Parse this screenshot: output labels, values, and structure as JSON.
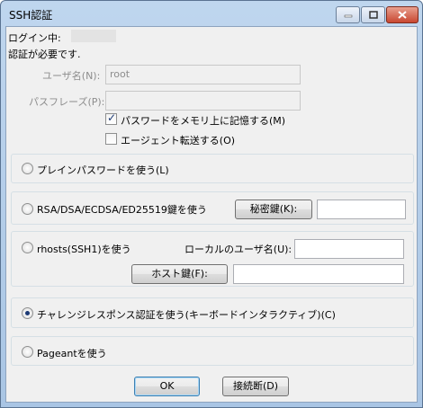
{
  "window": {
    "title": "SSH認証"
  },
  "status": {
    "logged_in_label": "ログイン中:",
    "auth_required": "認証が必要です."
  },
  "form": {
    "username_label": "ユーザ名(N):",
    "username_value": "root",
    "passphrase_label": "パスフレーズ(P):",
    "passphrase_value": "",
    "remember_label": "パスワードをメモリ上に記憶する(M)",
    "remember_checked": true,
    "agent_label": "エージェント転送する(O)",
    "agent_checked": false
  },
  "methods": {
    "plain": {
      "label": "プレインパスワードを使う(L)",
      "selected": false
    },
    "rsa": {
      "label": "RSA/DSA/ECDSA/ED25519鍵を使う",
      "selected": false,
      "button": "秘密鍵(K):",
      "value": ""
    },
    "rhosts": {
      "label": "rhosts(SSH1)を使う",
      "selected": false,
      "local_user_label": "ローカルのユーザ名(U):",
      "local_user_value": "",
      "hostkey_button": "ホスト鍵(F):",
      "hostkey_value": ""
    },
    "challenge": {
      "label": "チャレンジレスポンス認証を使う(キーボードインタラクティブ)(C)",
      "selected": true
    },
    "pageant": {
      "label": "Pageantを使う",
      "selected": false
    }
  },
  "buttons": {
    "ok": "OK",
    "disconnect": "接続断(D)"
  }
}
